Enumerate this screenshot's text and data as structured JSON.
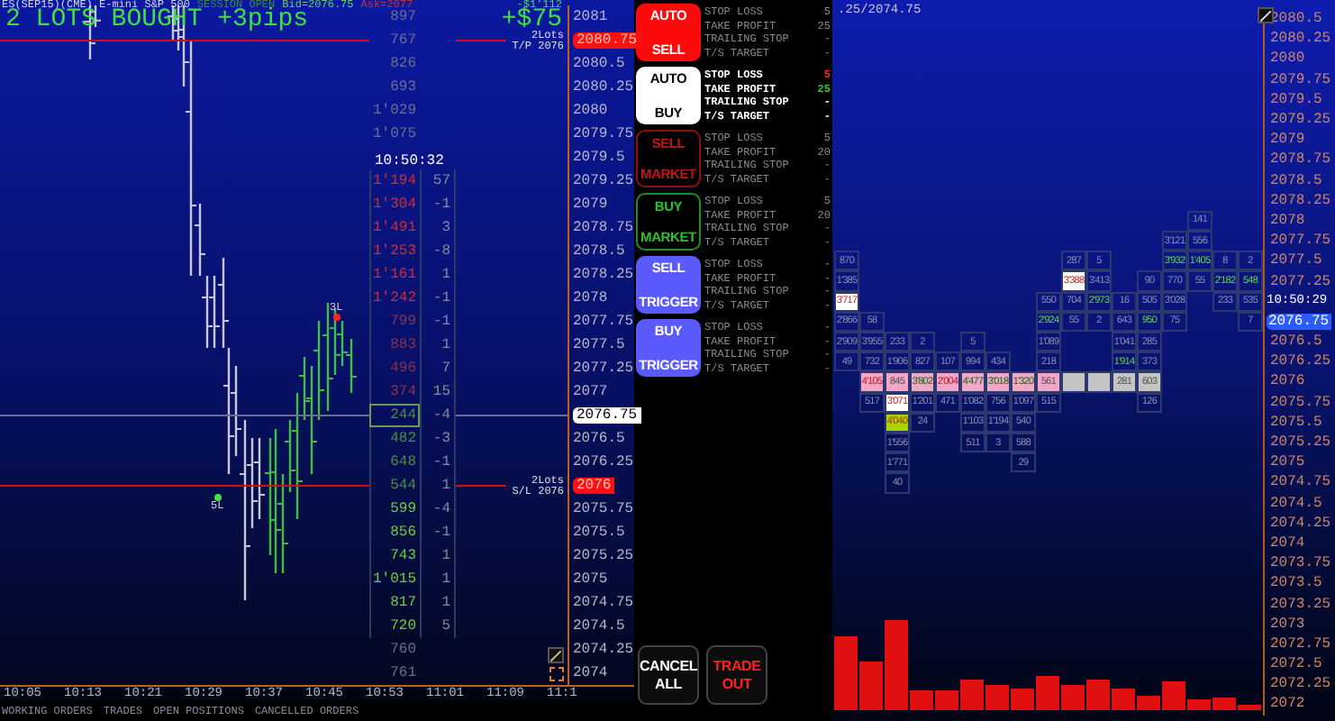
{
  "chart": {
    "header": {
      "symbol": "ES(SEP15)(CME) E-mini S&P 500",
      "session": "SESSION OPEN",
      "bid": "Bid=2076.75",
      "ask": "Ask=2077",
      "account_pnl": "-$1'112"
    },
    "banner": {
      "text": "2 LOTS BOUGHT +3pips",
      "pnl": "+$75"
    },
    "markers": [
      {
        "text": "3L",
        "kind": "sell"
      },
      {
        "text": "5L",
        "kind": "buy"
      }
    ],
    "rows": [
      {
        "price": "2081",
        "volume": "897",
        "kind": "neutral",
        "current": false
      },
      {
        "price": "2080.75",
        "volume": "767",
        "kind": "neutral",
        "current": false,
        "order": [
          "2Lots",
          "T/P 2076"
        ]
      },
      {
        "price": "2080.5",
        "volume": "826",
        "kind": "neutral",
        "current": false
      },
      {
        "price": "2080.25",
        "volume": "693",
        "kind": "neutral",
        "current": false
      },
      {
        "price": "2080",
        "volume": "1'029",
        "kind": "neutral",
        "current": false
      },
      {
        "price": "2079.75",
        "volume": "1'075",
        "kind": "neutral",
        "current": false
      },
      {
        "price": "2079.5",
        "time": "10:50:32"
      },
      {
        "price": "2079.25",
        "volume": "1'194",
        "kind": "sell",
        "delta": "57",
        "current": false
      },
      {
        "price": "2079",
        "volume": "1'304",
        "kind": "sell",
        "delta": "-1",
        "current": false
      },
      {
        "price": "2078.75",
        "volume": "1'491",
        "kind": "sell",
        "delta": "3",
        "current": false
      },
      {
        "price": "2078.5",
        "volume": "1'253",
        "kind": "sell",
        "delta": "-8",
        "current": false
      },
      {
        "price": "2078.25",
        "volume": "1'161",
        "kind": "sell",
        "delta": "1",
        "current": false
      },
      {
        "price": "2078",
        "volume": "1'242",
        "kind": "sell",
        "delta": "-1",
        "current": false
      },
      {
        "price": "2077.75",
        "volume": "799",
        "kind": "sell-dim",
        "delta": "-1",
        "current": false
      },
      {
        "price": "2077.5",
        "volume": "883",
        "kind": "sell-dim",
        "delta": "1",
        "current": false
      },
      {
        "price": "2077.25",
        "volume": "496",
        "kind": "sell-dim",
        "delta": "7",
        "current": false
      },
      {
        "price": "2077",
        "volume": "374",
        "kind": "sell-dim",
        "delta": "15",
        "current": false
      },
      {
        "price": "2076.75",
        "volume": "244",
        "kind": "buy-dim",
        "delta": "-4",
        "current": true,
        "last": true
      },
      {
        "price": "2076.5",
        "volume": "482",
        "kind": "buy-dim",
        "delta": "-3",
        "current": false
      },
      {
        "price": "2076.25",
        "volume": "648",
        "kind": "buy-dim",
        "delta": "-1",
        "current": false
      },
      {
        "price": "2076",
        "volume": "544",
        "kind": "buy-dim",
        "delta": "1",
        "current": false,
        "order": [
          "2Lots",
          "S/L 2076"
        ]
      },
      {
        "price": "2075.75",
        "volume": "599",
        "kind": "buy",
        "delta": "-4",
        "current": false
      },
      {
        "price": "2075.5",
        "volume": "856",
        "kind": "buy",
        "delta": "-1",
        "current": false
      },
      {
        "price": "2075.25",
        "volume": "743",
        "kind": "buy",
        "delta": "1",
        "current": false
      },
      {
        "price": "2075",
        "volume": "1'015",
        "kind": "buy",
        "delta": "1",
        "current": false
      },
      {
        "price": "2074.75",
        "volume": "817",
        "kind": "buy",
        "delta": "1",
        "current": false
      },
      {
        "price": "2074.5",
        "volume": "720",
        "kind": "buy",
        "delta": "5",
        "current": false
      },
      {
        "price": "2074.25",
        "volume": "760",
        "kind": "neutral",
        "current": false
      },
      {
        "price": "2074",
        "volume": "761",
        "kind": "neutral",
        "current": false
      }
    ],
    "time_axis": [
      "10:05",
      "10:13",
      "10:21",
      "10:29",
      "10:37",
      "10:45",
      "10:53",
      "11:01",
      "11:09",
      "11:1"
    ],
    "bottom_tabs": [
      "WORKING ORDERS",
      "TRADES",
      "OPEN POSITIONS",
      "CANCELLED ORDERS"
    ]
  },
  "order_buttons": [
    {
      "kind": "red-fill",
      "label": [
        "AUTO",
        "SELL"
      ],
      "active": false,
      "settings": [
        {
          "name": "STOP LOSS",
          "value": "5"
        },
        {
          "name": "TAKE PROFIT",
          "value": "25"
        },
        {
          "name": "TRAILING STOP",
          "value": "-"
        },
        {
          "name": "T/S TARGET",
          "value": "-"
        }
      ]
    },
    {
      "kind": "white-fill",
      "label": [
        "AUTO",
        "BUY"
      ],
      "active": true,
      "settings": [
        {
          "name": "STOP LOSS",
          "value": "5"
        },
        {
          "name": "TAKE PROFIT",
          "value": "25"
        },
        {
          "name": "TRAILING STOP",
          "value": "-"
        },
        {
          "name": "T/S TARGET",
          "value": "-"
        }
      ]
    },
    {
      "kind": "red-outline",
      "label": [
        "SELL",
        "MARKET"
      ],
      "active": false,
      "settings": [
        {
          "name": "STOP LOSS",
          "value": "5"
        },
        {
          "name": "TAKE PROFIT",
          "value": "20"
        },
        {
          "name": "TRAILING STOP",
          "value": "-"
        },
        {
          "name": "T/S TARGET",
          "value": "-"
        }
      ]
    },
    {
      "kind": "green-outline",
      "label": [
        "BUY",
        "MARKET"
      ],
      "active": false,
      "settings": [
        {
          "name": "STOP LOSS",
          "value": "5"
        },
        {
          "name": "TAKE PROFIT",
          "value": "20"
        },
        {
          "name": "TRAILING STOP",
          "value": "-"
        },
        {
          "name": "T/S TARGET",
          "value": "-"
        }
      ]
    },
    {
      "kind": "blue-fill",
      "label": [
        "SELL",
        "TRIGGER"
      ],
      "active": false,
      "settings": [
        {
          "name": "STOP LOSS",
          "value": "-"
        },
        {
          "name": "TAKE PROFIT",
          "value": "-"
        },
        {
          "name": "TRAILING STOP",
          "value": "-"
        },
        {
          "name": "T/S TARGET",
          "value": "-"
        }
      ]
    },
    {
      "kind": "blue-fill",
      "label": [
        "BUY",
        "TRIGGER"
      ],
      "active": false,
      "settings": [
        {
          "name": "STOP LOSS",
          "value": "-"
        },
        {
          "name": "TAKE PROFIT",
          "value": "-"
        },
        {
          "name": "TRAILING STOP",
          "value": "-"
        },
        {
          "name": "T/S TARGET",
          "value": "-"
        }
      ]
    }
  ],
  "bottom_buttons": [
    {
      "kind": "cancel",
      "label": [
        "CANCEL",
        "ALL"
      ]
    },
    {
      "kind": "exit",
      "label": [
        "TRADE",
        "OUT"
      ]
    }
  ],
  "footprint": {
    "range": ".25/2074.75",
    "rows": [
      {
        "price": "2080.5"
      },
      {
        "price": "2080.25"
      },
      {
        "price": "2080"
      },
      {
        "price": "2079.75"
      },
      {
        "price": "2079.5"
      },
      {
        "price": "2079.25"
      },
      {
        "price": "2079"
      },
      {
        "price": "2078.75"
      },
      {
        "price": "2078.5"
      },
      {
        "price": "2078.25"
      },
      {
        "price": "2078",
        "cells": [
          null,
          null,
          null,
          null,
          null,
          null,
          null,
          null,
          null,
          null,
          null,
          null,
          null,
          null,
          {
            "text": "141"
          },
          null,
          null
        ]
      },
      {
        "price": "2077.75",
        "cells": [
          null,
          null,
          null,
          null,
          null,
          null,
          null,
          null,
          null,
          null,
          null,
          null,
          null,
          {
            "text": "3'121"
          },
          {
            "text": "556"
          },
          null,
          null
        ]
      },
      {
        "price": "2077.5",
        "cells": [
          {
            "text": "870"
          },
          null,
          null,
          null,
          null,
          null,
          null,
          null,
          null,
          {
            "text": "287"
          },
          {
            "text": "5"
          },
          null,
          null,
          {
            "text": "3'932",
            "kind": "buy"
          },
          {
            "text": "1'405",
            "kind": "buy"
          },
          {
            "text": "8"
          },
          {
            "text": "2"
          }
        ]
      },
      {
        "price": "2077.25",
        "cells": [
          {
            "text": "1'385"
          },
          null,
          null,
          null,
          null,
          null,
          null,
          null,
          null,
          {
            "text": "3'388",
            "kind": "peak"
          },
          {
            "text": "3'413"
          },
          null,
          {
            "text": "90"
          },
          {
            "text": "770"
          },
          {
            "text": "55"
          },
          {
            "text": "2'182",
            "kind": "buy"
          },
          {
            "text": "548",
            "kind": "buy"
          }
        ]
      },
      {
        "time": "10:50:29",
        "cells": [
          {
            "text": "3'717",
            "kind": "peak"
          },
          null,
          null,
          null,
          null,
          null,
          null,
          null,
          {
            "text": "550"
          },
          {
            "text": "704"
          },
          {
            "text": "2'973",
            "kind": "buy"
          },
          {
            "text": "16"
          },
          {
            "text": "505"
          },
          {
            "text": "3'028"
          },
          null,
          {
            "text": "233"
          },
          {
            "text": "535"
          }
        ]
      },
      {
        "price": "2076.75",
        "last": true,
        "cells": [
          {
            "text": "2'866"
          },
          {
            "text": "58"
          },
          null,
          null,
          null,
          null,
          null,
          null,
          {
            "text": "2'924",
            "kind": "buy"
          },
          {
            "text": "55"
          },
          {
            "text": "2"
          },
          {
            "text": "643"
          },
          {
            "text": "950",
            "kind": "buy"
          },
          {
            "text": "75"
          },
          null,
          null,
          {
            "text": "7"
          }
        ]
      },
      {
        "price": "2076.5",
        "cells": [
          {
            "text": "2'909"
          },
          {
            "text": "3'955"
          },
          {
            "text": "233"
          },
          {
            "text": "2"
          },
          null,
          {
            "text": "5"
          },
          null,
          null,
          {
            "text": "1'089"
          },
          null,
          null,
          {
            "text": "1'041"
          },
          {
            "text": "285"
          },
          null,
          null,
          null,
          null
        ]
      },
      {
        "price": "2076.25",
        "cells": [
          {
            "text": "49"
          },
          {
            "text": "732"
          },
          {
            "text": "1'906"
          },
          {
            "text": "827"
          },
          {
            "text": "107"
          },
          {
            "text": "994"
          },
          {
            "text": "434"
          },
          null,
          {
            "text": "218"
          },
          null,
          null,
          {
            "text": "1'914",
            "kind": "buy"
          },
          {
            "text": "373"
          },
          null,
          null,
          null,
          null
        ]
      },
      {
        "price": "2076",
        "cells": [
          null,
          {
            "text": "4'105",
            "kind": "range-sell"
          },
          {
            "text": "845",
            "kind": "range"
          },
          {
            "text": "3'802",
            "kind": "range-buy"
          },
          {
            "text": "2'004",
            "kind": "range-sell"
          },
          {
            "text": "4'477",
            "kind": "range-buy"
          },
          {
            "text": "3'018",
            "kind": "range-buy"
          },
          {
            "text": "1'320",
            "kind": "range-buy"
          },
          {
            "text": "561",
            "kind": "range"
          },
          {
            "kind": "gap"
          },
          {
            "kind": "gap"
          },
          {
            "text": "281",
            "kind": "gap"
          },
          {
            "text": "603",
            "kind": "gap"
          },
          null,
          null,
          null,
          null
        ]
      },
      {
        "price": "2075.75",
        "cells": [
          null,
          {
            "text": "517"
          },
          {
            "text": "3'071",
            "kind": "peak"
          },
          {
            "text": "1'201"
          },
          {
            "text": "471"
          },
          {
            "text": "1'082"
          },
          {
            "text": "756"
          },
          {
            "text": "1'097"
          },
          {
            "text": "515"
          },
          null,
          null,
          null,
          {
            "text": "126"
          },
          null,
          null,
          null,
          null
        ]
      },
      {
        "price": "2075.5",
        "cells": [
          null,
          null,
          {
            "text": "4'040",
            "kind": "poc"
          },
          {
            "text": "24"
          },
          null,
          {
            "text": "1'103"
          },
          {
            "text": "1'194"
          },
          {
            "text": "540"
          },
          null,
          null,
          null,
          null,
          null,
          null,
          null,
          null,
          null
        ]
      },
      {
        "price": "2075.25",
        "cells": [
          null,
          null,
          {
            "text": "1'556"
          },
          null,
          null,
          {
            "text": "511"
          },
          {
            "text": "3"
          },
          {
            "text": "588"
          },
          null,
          null,
          null,
          null,
          null,
          null,
          null,
          null,
          null
        ]
      },
      {
        "price": "2075",
        "cells": [
          null,
          null,
          {
            "text": "1'771"
          },
          null,
          null,
          null,
          null,
          {
            "text": "29"
          },
          null,
          null,
          null,
          null,
          null,
          null,
          null,
          null,
          null
        ]
      },
      {
        "price": "2074.75",
        "cells": [
          null,
          null,
          {
            "text": "40"
          },
          null,
          null,
          null,
          null,
          null,
          null,
          null,
          null,
          null,
          null,
          null,
          null,
          null,
          null
        ]
      },
      {
        "price": "2074.5"
      },
      {
        "price": "2074.25"
      },
      {
        "price": "2074"
      },
      {
        "price": "2073.75"
      },
      {
        "price": "2073.5"
      },
      {
        "price": "2073.25"
      },
      {
        "price": "2073"
      },
      {
        "price": "2072.75"
      },
      {
        "price": "2072.5"
      },
      {
        "price": "2072.25"
      },
      {
        "price": "2072"
      }
    ]
  }
}
